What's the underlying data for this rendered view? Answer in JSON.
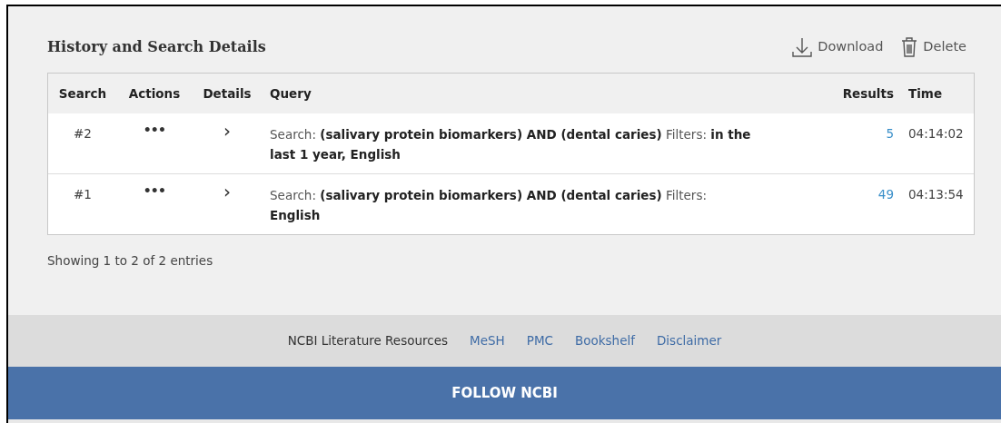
{
  "title": "History and Search Details",
  "toolbar": [
    {
      "kind": "download",
      "label": "Download"
    },
    {
      "kind": "delete",
      "label": "Delete"
    }
  ],
  "table": {
    "columns": [
      "Search",
      "Actions",
      "Details",
      "Query",
      "Results",
      "Time"
    ],
    "rows": [
      {
        "search": "#2",
        "actions": "•••",
        "details": "›",
        "query": "Search: **(salivary protein biomarkers) AND (dental caries)** Filters: **in the last 1 year, English**",
        "results": "5",
        "time": "04:14:02"
      },
      {
        "search": "#1",
        "actions": "•••",
        "details": "›",
        "query": "Search: **(salivary protein biomarkers) AND (dental caries)** Filters: **English**",
        "results": "49",
        "time": "04:13:54"
      }
    ]
  },
  "entries_info": "Showing 1 to 2 of 2 entries",
  "footer_links": [
    {
      "label": "NCBI Literature Resources",
      "kind": "text"
    },
    {
      "label": "MeSH",
      "kind": "link"
    },
    {
      "label": "PMC",
      "kind": "link"
    },
    {
      "label": "Bookshelf",
      "kind": "link"
    },
    {
      "label": "Disclaimer",
      "kind": "link"
    }
  ],
  "follow_banner": "FOLLOW NCBI"
}
